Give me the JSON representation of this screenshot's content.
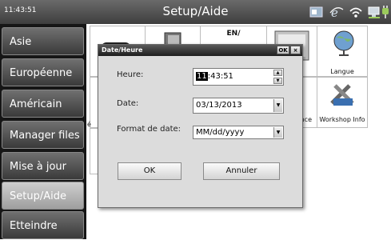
{
  "status_bar": {
    "clock": "11:43:51",
    "title": "Setup/Aide",
    "icons": [
      "cube-window-icon",
      "ie-browser-icon",
      "wifi-icon",
      "network-computer-icon",
      "power-plug-icon"
    ]
  },
  "sidebar": {
    "items": [
      {
        "label": "Asie",
        "active": false
      },
      {
        "label": "Européenne",
        "active": false
      },
      {
        "label": "Américain",
        "active": false
      },
      {
        "label": "Manager files",
        "active": false
      },
      {
        "label": "Mise à jour",
        "active": false
      },
      {
        "label": "Setup/Aide",
        "active": true
      },
      {
        "label": "Etteindre",
        "active": false
      }
    ]
  },
  "grid": {
    "visible_labels": {
      "en_icon": "EN/",
      "langue": "Langue",
      "partial_left": "é",
      "partial_nce": "nce",
      "partial_e": "e",
      "workshop": "Workshop Info"
    }
  },
  "dialog": {
    "title": "Date/Heure",
    "ok_small": "OK",
    "close_small": "×",
    "time_label": "Heure:",
    "time_hour": "11",
    "time_rest": ":43:51",
    "date_label": "Date:",
    "date_value": "03/13/2013",
    "format_label": "Format de date:",
    "format_value": "MM/dd/yyyy",
    "ok_button": "OK",
    "cancel_button": "Annuler"
  },
  "colors": {
    "bar_dark": "#3e3e3e",
    "sidebar_bg": "#161616",
    "active_item": "#b5b5b5",
    "dialog_bg": "#dcdcdc",
    "selection": "#000000"
  }
}
